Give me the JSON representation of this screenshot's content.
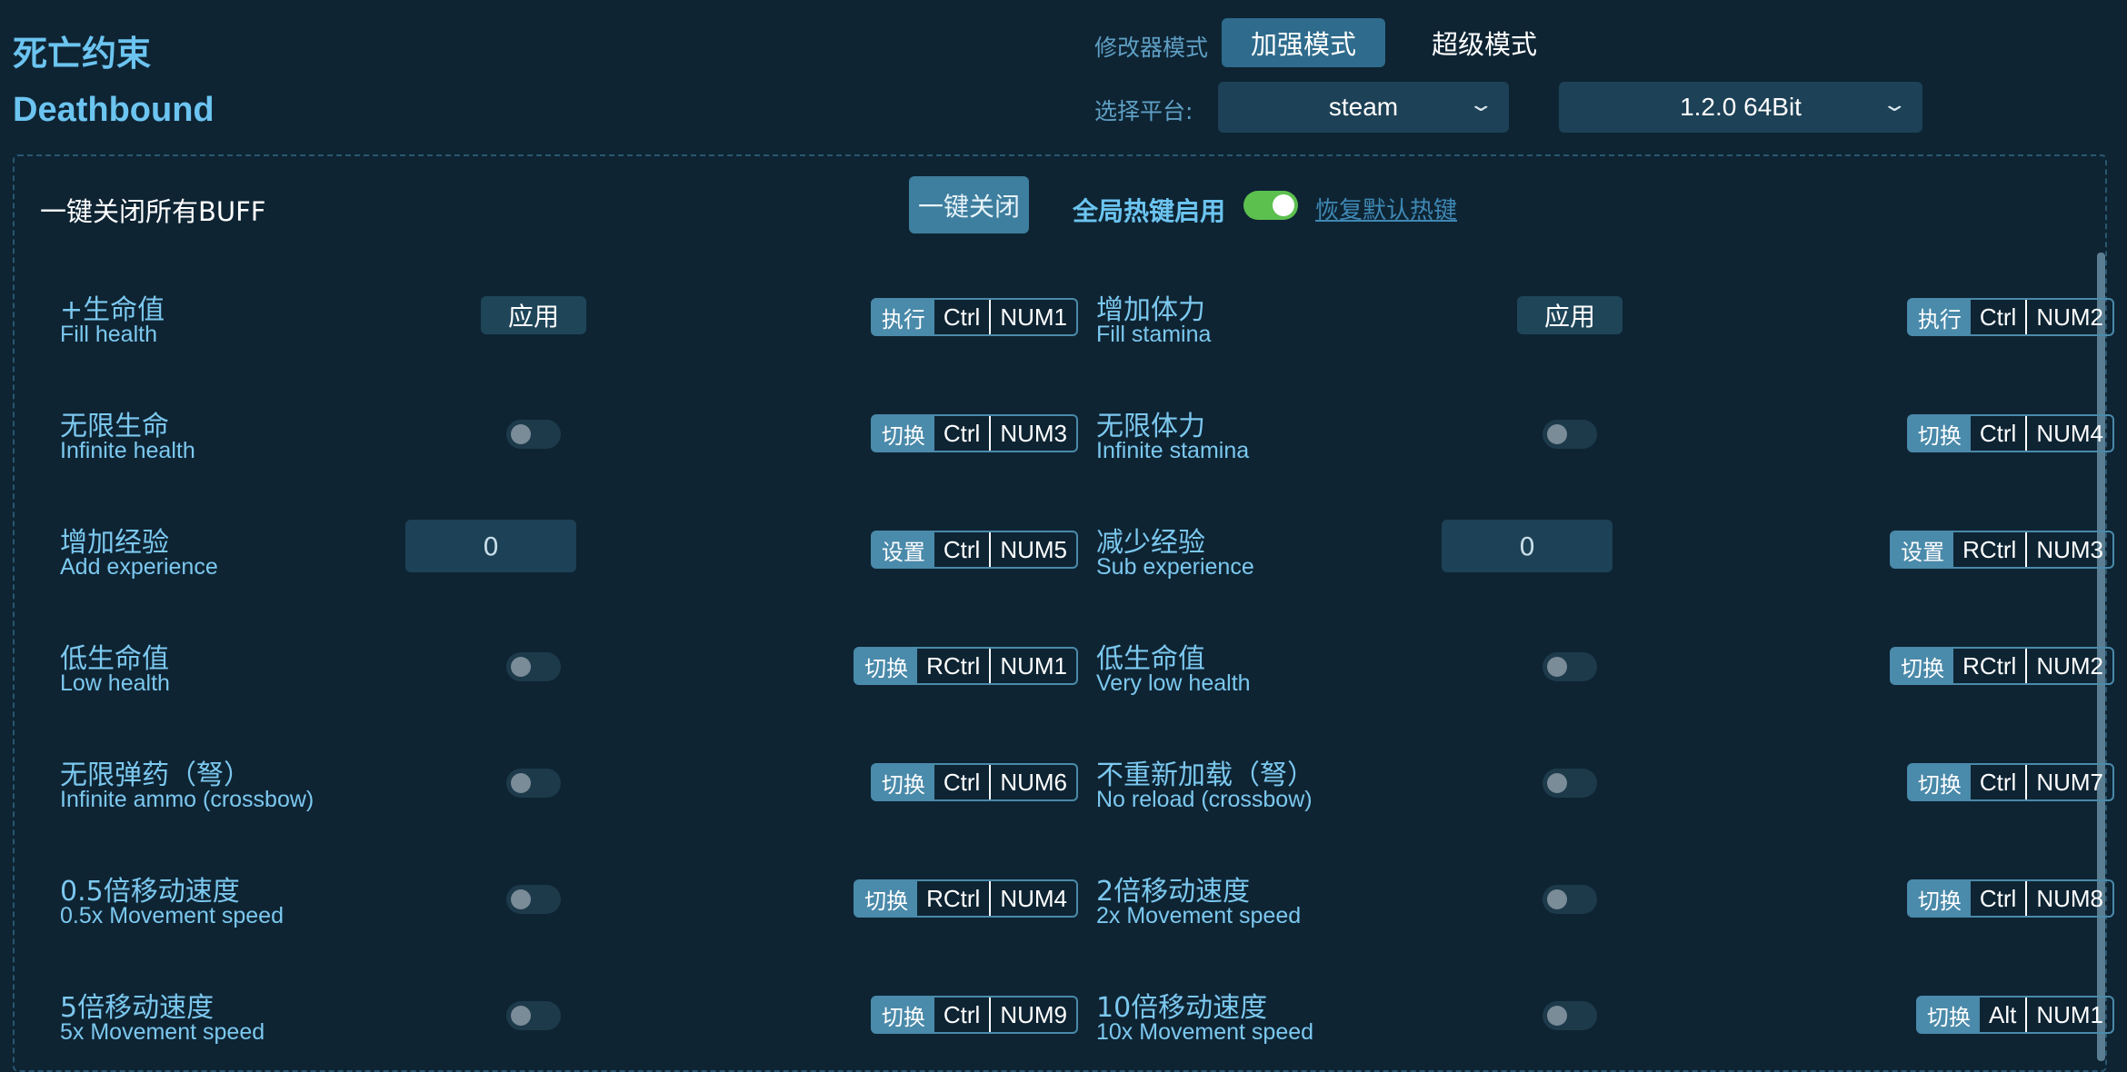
{
  "header": {
    "title_cn": "死亡约束",
    "title_en": "Deathbound",
    "mode_label": "修改器模式",
    "mode_active": "加强模式",
    "mode_other": "超级模式",
    "platform_label": "选择平台:",
    "platform_value": "steam",
    "version_value": "1.2.0 64Bit"
  },
  "toolbar": {
    "buff_label": "一键关闭所有BUFF",
    "close_all": "一键关闭",
    "hotkey_label": "全局热键启用",
    "hotkey_enabled": true,
    "restore_link": "恢复默认热键"
  },
  "left": [
    {
      "cn": "+生命值",
      "en": "Fill health",
      "control": "button",
      "button": "应用",
      "action": "执行",
      "k1": "Ctrl",
      "k2": "NUM1"
    },
    {
      "cn": "无限生命",
      "en": "Infinite health",
      "control": "toggle",
      "action": "切换",
      "k1": "Ctrl",
      "k2": "NUM3"
    },
    {
      "cn": "增加经验",
      "en": "Add experience",
      "control": "input",
      "value": "0",
      "action": "设置",
      "k1": "Ctrl",
      "k2": "NUM5"
    },
    {
      "cn": "低生命值",
      "en": "Low health",
      "control": "toggle",
      "action": "切换",
      "k1": "RCtrl",
      "k2": "NUM1"
    },
    {
      "cn": "无限弹药（弩）",
      "en": "Infinite ammo (crossbow)",
      "control": "toggle",
      "action": "切换",
      "k1": "Ctrl",
      "k2": "NUM6"
    },
    {
      "cn": "0.5倍移动速度",
      "en": "0.5x Movement speed",
      "control": "toggle",
      "action": "切换",
      "k1": "RCtrl",
      "k2": "NUM4"
    },
    {
      "cn": "5倍移动速度",
      "en": "5x Movement speed",
      "control": "toggle",
      "action": "切换",
      "k1": "Ctrl",
      "k2": "NUM9"
    }
  ],
  "right": [
    {
      "cn": "增加体力",
      "en": "Fill stamina",
      "control": "button",
      "button": "应用",
      "action": "执行",
      "k1": "Ctrl",
      "k2": "NUM2"
    },
    {
      "cn": "无限体力",
      "en": "Infinite stamina",
      "control": "toggle",
      "action": "切换",
      "k1": "Ctrl",
      "k2": "NUM4"
    },
    {
      "cn": "减少经验",
      "en": "Sub experience",
      "control": "input",
      "value": "0",
      "action": "设置",
      "k1": "RCtrl",
      "k2": "NUM3"
    },
    {
      "cn": "低生命值",
      "en": "Very low health",
      "control": "toggle",
      "action": "切换",
      "k1": "RCtrl",
      "k2": "NUM2"
    },
    {
      "cn": "不重新加载（弩）",
      "en": "No reload (crossbow)",
      "control": "toggle",
      "action": "切换",
      "k1": "Ctrl",
      "k2": "NUM7"
    },
    {
      "cn": "2倍移动速度",
      "en": "2x Movement speed",
      "control": "toggle",
      "action": "切换",
      "k1": "Ctrl",
      "k2": "NUM8"
    },
    {
      "cn": "10倍移动速度",
      "en": "10x Movement speed",
      "control": "toggle",
      "action": "切换",
      "k1": "Alt",
      "k2": "NUM1"
    }
  ]
}
